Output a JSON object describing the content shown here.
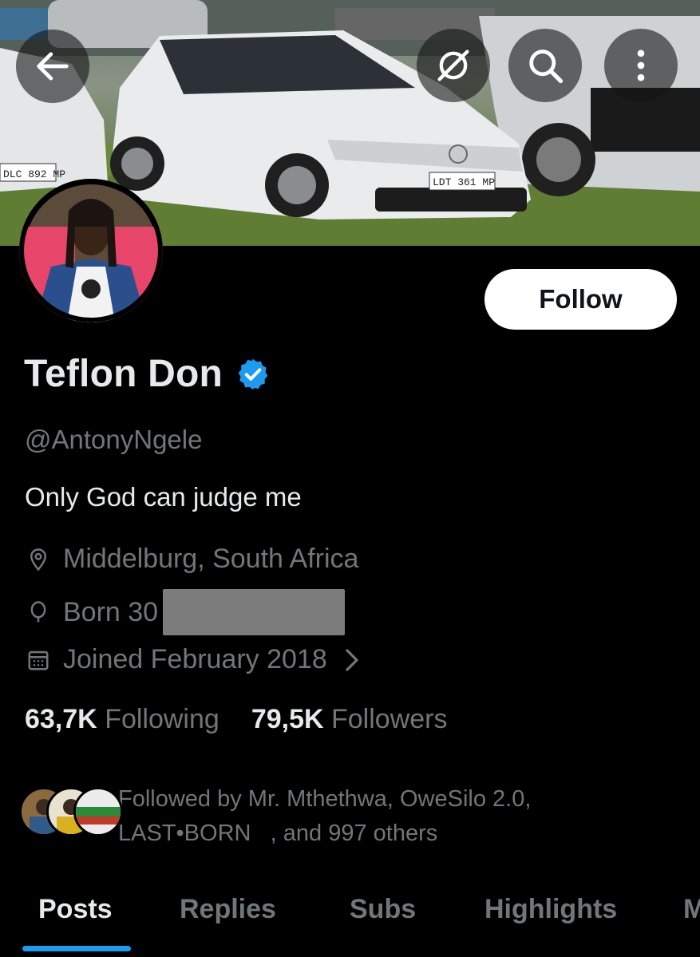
{
  "profile": {
    "display_name": "Teflon Don",
    "handle": "@AntonyNgele",
    "bio": "Only God can judge me",
    "location": "Middelburg, South Africa",
    "birth_prefix": "Born 30",
    "joined": "Joined February 2018"
  },
  "actions": {
    "follow_label": "Follow"
  },
  "stats": {
    "following_count": "63,7K",
    "following_label": "Following",
    "followers_count": "79,5K",
    "followers_label": "Followers"
  },
  "followed_by": {
    "line1": "Followed by Mr. Mthethwa, OweSilo 2.0,",
    "line2": "LAST•BORN   , and 997 others"
  },
  "banner": {
    "plate_center": "LDT 361 MP",
    "plate_left": "DLC 892 MP"
  },
  "tabs": [
    {
      "label": "Posts"
    },
    {
      "label": "Replies"
    },
    {
      "label": "Subs"
    },
    {
      "label": "Highlights"
    },
    {
      "label": "M"
    }
  ],
  "icons": {
    "back": "arrow-left-icon",
    "grok": "grok-icon",
    "search": "search-icon",
    "more": "more-vertical-icon",
    "verified": "verified-badge-icon",
    "location": "location-pin-icon",
    "birthday": "balloon-icon",
    "calendar": "calendar-icon",
    "chevron": "chevron-right-icon"
  },
  "colors": {
    "background": "#000000",
    "text_primary": "#e7e9ea",
    "text_secondary": "#71767b",
    "accent": "#1d9bf0",
    "follow_bg": "#ffffff"
  }
}
